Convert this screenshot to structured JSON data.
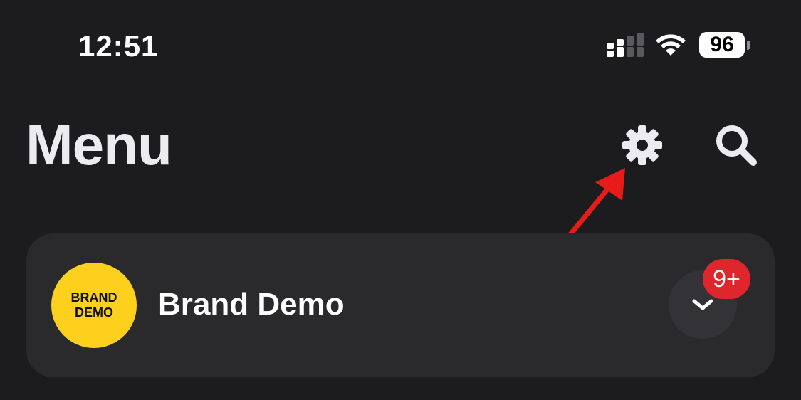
{
  "status_bar": {
    "time": "12:51",
    "battery_level": "96",
    "icons": [
      "signal-icon",
      "wifi-icon",
      "battery-icon"
    ]
  },
  "header": {
    "title": "Menu",
    "icons": [
      "gear-icon",
      "search-icon"
    ]
  },
  "annotation": {
    "icon": "red-arrow-icon",
    "color": "#e81b1b"
  },
  "account": {
    "name": "Brand Demo",
    "logo_line1": "BRAND",
    "logo_line2": "DEMO",
    "logo_color": "#fdd01e",
    "badge": "9+",
    "badge_color": "#e0262d",
    "expand_icon": "chevron-down-icon"
  }
}
